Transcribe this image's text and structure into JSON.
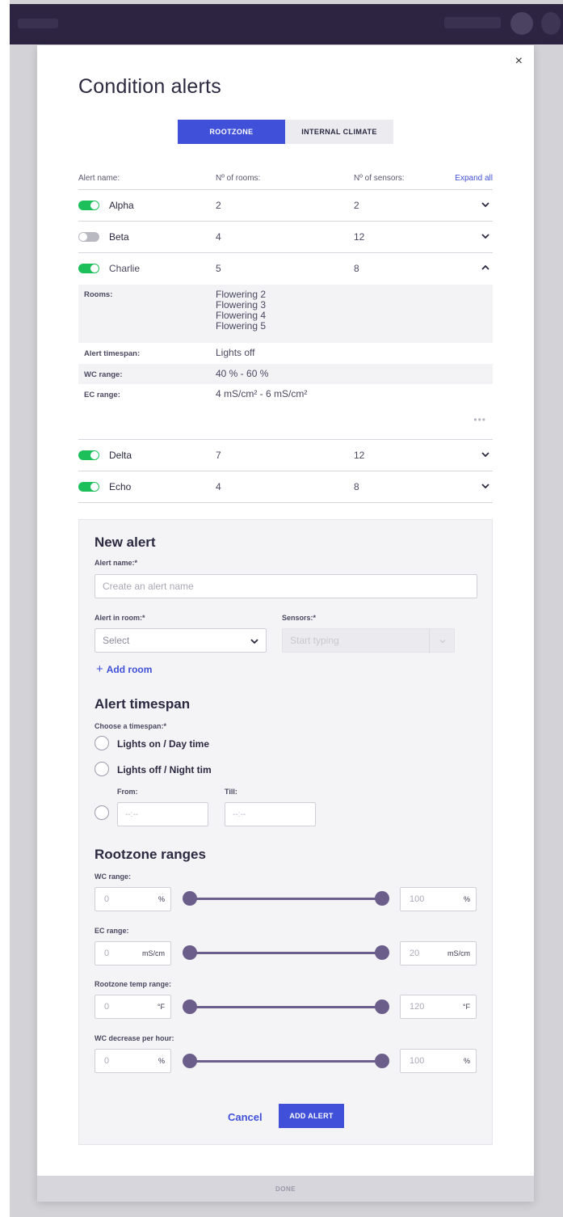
{
  "modal": {
    "title": "Condition alerts",
    "close_glyph": "×"
  },
  "tabs": [
    {
      "label": "ROOTZONE",
      "active": true
    },
    {
      "label": "INTERNAL CLIMATE",
      "active": false
    }
  ],
  "table": {
    "headers": {
      "name": "Alert name:",
      "rooms": "Nº of rooms:",
      "sensors": "Nº of sensors:",
      "expand": "Expand all"
    },
    "rows": [
      {
        "name": "Alpha",
        "rooms": "2",
        "sensors": "2",
        "enabled": true
      },
      {
        "name": "Beta",
        "rooms": "4",
        "sensors": "12",
        "enabled": false
      },
      {
        "name": "Charlie",
        "rooms": "5",
        "sensors": "8",
        "enabled": true,
        "expanded": true
      },
      {
        "name": "Delta",
        "rooms": "7",
        "sensors": "12",
        "enabled": true
      },
      {
        "name": "Echo",
        "rooms": "4",
        "sensors": "8",
        "enabled": true
      }
    ],
    "details": {
      "rooms_label": "Rooms:",
      "rooms": [
        "Flowering 2",
        "Flowering 3",
        "Flowering 4",
        "Flowering 5"
      ],
      "timespan_label": "Alert timespan:",
      "timespan_value": "Lights off",
      "wc_label": "WC range:",
      "wc_value": "40 % - 60 %",
      "ec_label": "EC range:",
      "ec_value": "4 mS/cm² - 6 mS/cm²",
      "more": "•••"
    }
  },
  "new_alert": {
    "heading": "New alert",
    "name_label": "Alert name:*",
    "name_placeholder": "Create an alert name",
    "room_label": "Alert in room:*",
    "room_value": "Select",
    "sensors_label": "Sensors:*",
    "sensors_placeholder": "Start typing",
    "add_room": "Add room",
    "add_room_glyph": "+",
    "timespan_heading": "Alert timespan",
    "timespan_label": "Choose a timespan:*",
    "option_day": "Lights on / Day time",
    "option_night": "Lights off / Night tim",
    "from_label": "From:",
    "till_label": "Till:",
    "from_placeholder": "--:--",
    "till_placeholder": "--:--",
    "ranges_heading": "Rootzone ranges",
    "ranges": [
      {
        "label": "WC range:",
        "min": "0",
        "max": "100",
        "unit": "%"
      },
      {
        "label": "EC range:",
        "min": "0",
        "max": "20",
        "unit": "mS/cm"
      },
      {
        "label": "Rootzone temp range:",
        "min": "0",
        "max": "120",
        "unit": "°F"
      },
      {
        "label": "WC decrease per hour:",
        "min": "0",
        "max": "100",
        "unit": "%"
      }
    ],
    "cancel": "Cancel",
    "submit": "ADD ALERT"
  },
  "footer": {
    "done": "DONE"
  },
  "colors": {
    "accent": "#4050d8",
    "toggle_on": "#1dbf5a",
    "slider": "#6b5e8a",
    "topbar": "#2c2440"
  }
}
